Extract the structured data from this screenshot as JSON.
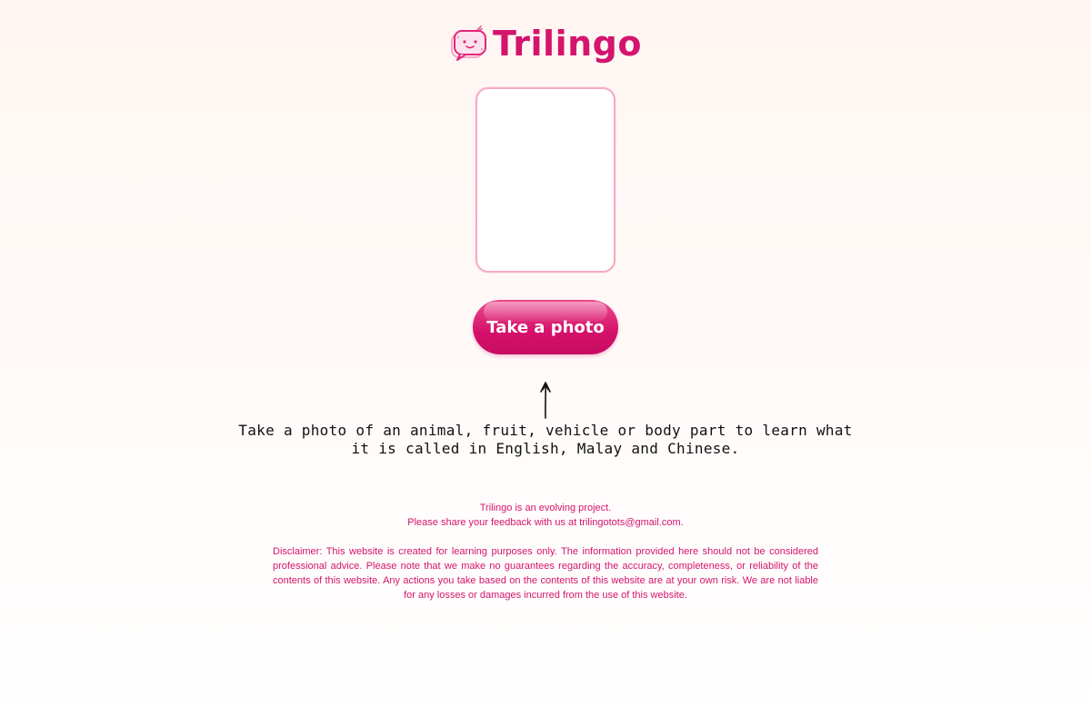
{
  "app": {
    "name": "Trilingo",
    "logo_icon": "tv-speech-bubble-icon",
    "brand_color": "#d4146d",
    "frame_color": "#f7a9c7"
  },
  "camera": {
    "button_label": "Take a photo"
  },
  "instruction": {
    "text": "Take a photo of an animal, fruit, vehicle or body part to learn what it is called in English, Malay and Chinese."
  },
  "footer": {
    "line1": "Trilingo is an evolving project.",
    "line2": "Please share your feedback with us at trilingotots@gmail.com.",
    "disclaimer": "Disclaimer: This website is created for learning purposes only. The information provided here should not be considered professional advice. Please note that we make no guarantees regarding the accuracy, completeness, or reliability of the contents of this website. Any actions you take based on the contents of this website are at your own risk. We are not liable for any losses or damages incurred from the use of this website."
  }
}
